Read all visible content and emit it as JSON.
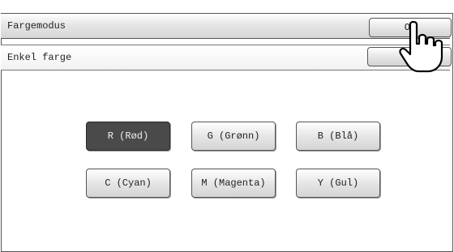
{
  "header": {
    "title": "Fargemodus",
    "ok_label": "OK"
  },
  "mode": {
    "label": "Enkel farge",
    "button_label": ""
  },
  "colors": [
    {
      "label": "R (Rød)",
      "selected": true
    },
    {
      "label": "G (Grønn)",
      "selected": false
    },
    {
      "label": "B (Blå)",
      "selected": false
    },
    {
      "label": "C (Cyan)",
      "selected": false
    },
    {
      "label": "M (Magenta)",
      "selected": false
    },
    {
      "label": "Y (Gul)",
      "selected": false
    }
  ],
  "icons": {
    "pointer": "hand-pointer-icon"
  },
  "palette": {
    "selected_bg": "#4a4a4a",
    "frame": "#555555"
  }
}
